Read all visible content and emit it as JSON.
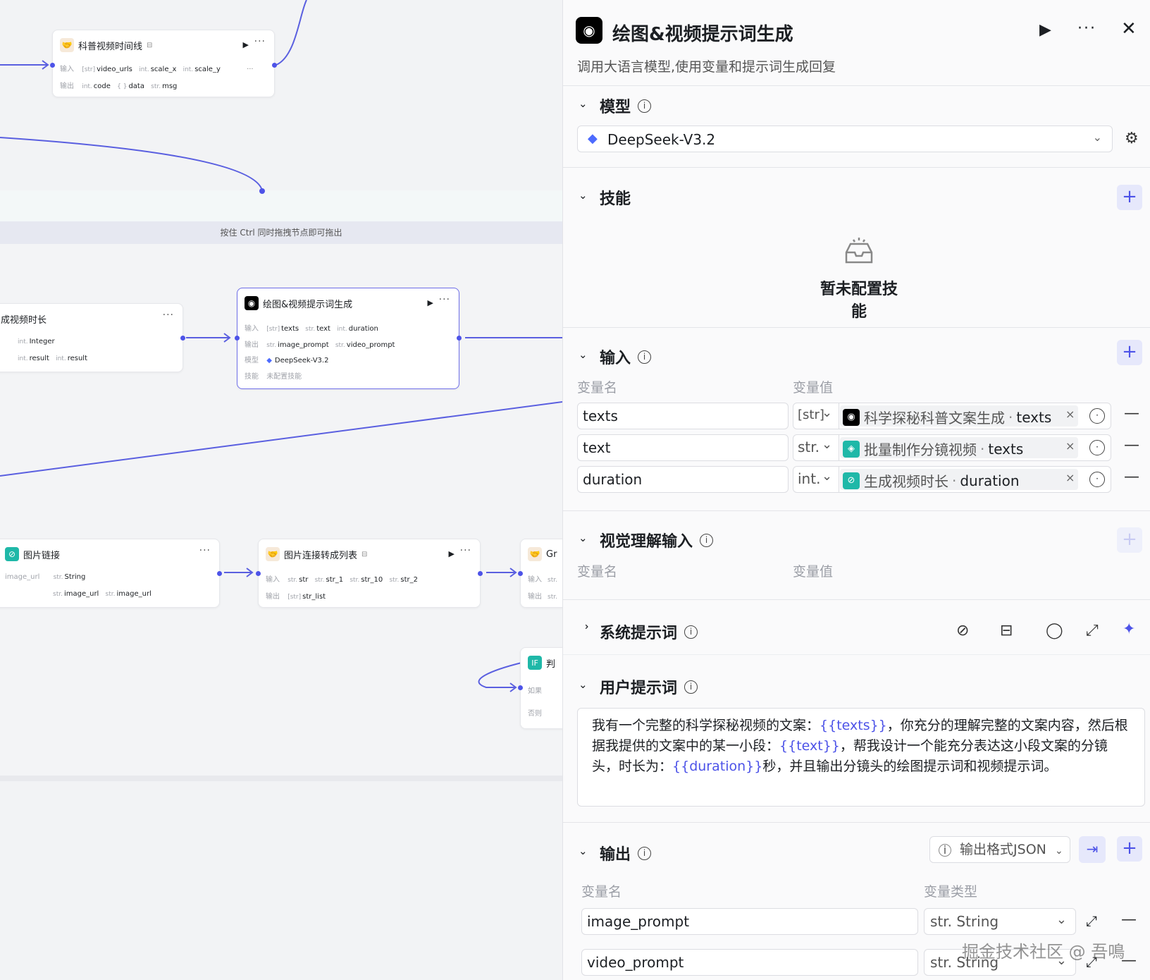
{
  "canvas": {
    "hint": "按住 Ctrl 同时拖拽节点即可拖出",
    "nodes": {
      "timeline": {
        "title": "科普视频时间线",
        "in_label": "输入",
        "out_label": "输出",
        "inputs": [
          {
            "type": "[str]",
            "name": "video_urls"
          },
          {
            "type": "int.",
            "name": "scale_x"
          },
          {
            "type": "int.",
            "name": "scale_y"
          }
        ],
        "outputs": [
          {
            "type": "int.",
            "name": "code"
          },
          {
            "type": "{ }",
            "name": "data"
          },
          {
            "type": "str.",
            "name": "msg"
          }
        ]
      },
      "duration": {
        "title": "成视频时长",
        "rows": [
          {
            "type": "int.",
            "name": "Integer"
          }
        ],
        "rows2": [
          {
            "type": "int.",
            "name": "result"
          },
          {
            "type": "int.",
            "name": "result"
          }
        ]
      },
      "prompt": {
        "title": "绘图&视频提示词生成",
        "in_label": "输入",
        "out_label": "输出",
        "model_label": "模型",
        "skill_label": "技能",
        "inputs": [
          {
            "type": "[str]",
            "name": "texts"
          },
          {
            "type": "str.",
            "name": "text"
          },
          {
            "type": "int.",
            "name": "duration"
          }
        ],
        "outputs": [
          {
            "type": "str.",
            "name": "image_prompt"
          },
          {
            "type": "str.",
            "name": "video_prompt"
          }
        ],
        "model": "DeepSeek-V3.2",
        "skill": "未配置技能"
      },
      "imglink": {
        "title": "图片链接",
        "left": "image_url",
        "rows": [
          {
            "type": "str.",
            "name": "String"
          }
        ],
        "rows2": [
          {
            "type": "str.",
            "name": "image_url"
          },
          {
            "type": "str.",
            "name": "image_url"
          }
        ]
      },
      "imglist": {
        "title": "图片连接转成列表",
        "in_label": "输入",
        "out_label": "输出",
        "inputs": [
          {
            "type": "str.",
            "name": "str"
          },
          {
            "type": "str.",
            "name": "str_1"
          },
          {
            "type": "str.",
            "name": "str_10"
          },
          {
            "type": "str.",
            "name": "str_2"
          }
        ],
        "outputs": [
          {
            "type": "[str]",
            "name": "str_list"
          }
        ]
      },
      "gr": {
        "title": "Gr",
        "in_label": "输入",
        "out_label": "输出",
        "in_type": "str.",
        "out_type": "str."
      },
      "judge": {
        "title": "判",
        "if_label": "IF",
        "case1": "如果",
        "case2": "否则"
      }
    }
  },
  "panel": {
    "title": "绘图&视频提示词生成",
    "description": "调用大语言模型,使用变量和提示词生成回复",
    "sections": {
      "model": {
        "label": "模型",
        "value": "DeepSeek-V3.2"
      },
      "skills": {
        "label": "技能",
        "empty": "暂未配置技能"
      },
      "input": {
        "label": "输入",
        "col_name": "变量名",
        "col_value": "变量值",
        "rows": [
          {
            "name": "texts",
            "type": "[str]",
            "src": "科学探秘科普文案生成",
            "field": "texts",
            "icon_color": "#000000"
          },
          {
            "name": "text",
            "type": "str.",
            "src": "批量制作分镜视频",
            "field": "texts",
            "icon_color": "#1fb8a8"
          },
          {
            "name": "duration",
            "type": "int.",
            "src": "生成视频时长",
            "field": "duration",
            "icon_color": "#1fb8a8"
          }
        ]
      },
      "vision": {
        "label": "视觉理解输入",
        "col_name": "变量名",
        "col_value": "变量值"
      },
      "system": {
        "label": "系统提示词"
      },
      "user": {
        "label": "用户提示词",
        "segments": [
          {
            "t": "我有一个完整的科学探秘视频的文案：",
            "v": false
          },
          {
            "t": "{{texts}}",
            "v": true
          },
          {
            "t": "，你充分的理解完整的文案内容，然后根据我提供的文案中的某一小段：",
            "v": false
          },
          {
            "t": "{{text}}",
            "v": true
          },
          {
            "t": "，帮我设计一个能充分表达这小段文案的分镜头，时长为：",
            "v": false
          },
          {
            "t": "{{duration}}",
            "v": true
          },
          {
            "t": "秒，并且输出分镜头的绘图提示词和视频提示词。",
            "v": false
          }
        ]
      },
      "output": {
        "label": "输出",
        "format": "输出格式JSON",
        "col_name": "变量名",
        "col_type": "变量类型",
        "rows": [
          {
            "name": "image_prompt",
            "type": "String"
          },
          {
            "name": "video_prompt",
            "type": "String"
          }
        ]
      }
    },
    "watermark": "掘金技术社区 @ 吾鳴",
    "colors": {
      "accent": "#4d53e8",
      "variable": "#4d53e8",
      "teal": "#1fb8a8"
    }
  }
}
